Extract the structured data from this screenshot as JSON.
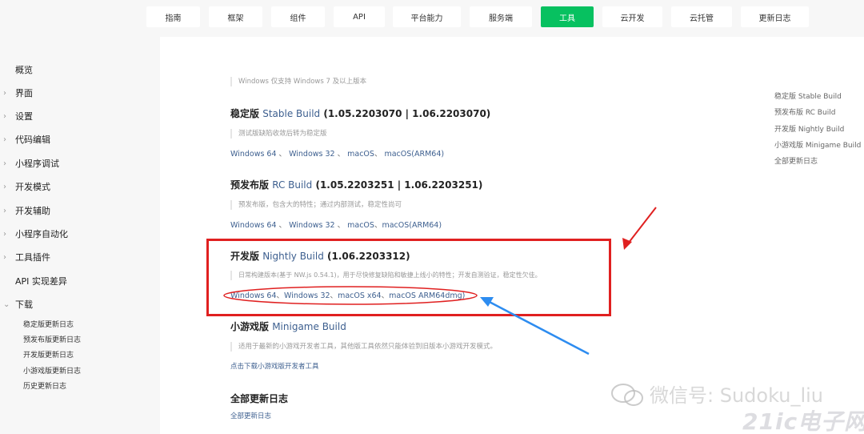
{
  "topnav": {
    "tabs": [
      {
        "label": "指南"
      },
      {
        "label": "框架"
      },
      {
        "label": "组件"
      },
      {
        "label": "API"
      },
      {
        "label": "平台能力"
      },
      {
        "label": "服务端"
      },
      {
        "label": "工具",
        "active": true
      },
      {
        "label": "云开发"
      },
      {
        "label": "云托管"
      },
      {
        "label": "更新日志"
      }
    ]
  },
  "sidebar": {
    "items": [
      {
        "label": "概览"
      },
      {
        "label": "界面"
      },
      {
        "label": "设置"
      },
      {
        "label": "代码编辑"
      },
      {
        "label": "小程序调试"
      },
      {
        "label": "开发模式"
      },
      {
        "label": "开发辅助"
      },
      {
        "label": "小程序自动化"
      },
      {
        "label": "工具插件"
      },
      {
        "label": "API 实现差异"
      },
      {
        "label": "下载"
      }
    ],
    "sub_items": [
      {
        "label": "稳定版更新日志"
      },
      {
        "label": "预发布版更新日志"
      },
      {
        "label": "开发版更新日志"
      },
      {
        "label": "小游戏版更新日志"
      },
      {
        "label": "历史更新日志"
      }
    ]
  },
  "main": {
    "top_note": "Windows 仅支持 Windows 7 及以上版本",
    "stable": {
      "title_prefix": "稳定版",
      "title_link": "Stable Build",
      "title_version": "(1.05.2203070 | 1.06.2203070)",
      "note": "测试版缺陷收敛后转为稳定版",
      "links": [
        "Windows 64",
        "Windows 32",
        "macOS",
        "macOS(ARM64)"
      ]
    },
    "rc": {
      "title_prefix": "预发布版",
      "title_link": "RC Build",
      "title_version": "(1.05.2203251 | 1.06.2203251)",
      "note": "预发布版，包含大的特性；通过内部测试，稳定性尚可",
      "links": [
        "Windows 64",
        "Windows 32",
        "macOS",
        "macOS(ARM64)"
      ]
    },
    "nightly": {
      "title_prefix": "开发版",
      "title_link": "Nightly Build",
      "title_version": "(1.06.2203312)",
      "note": "日常构建版本(基于 NW.js 0.54.1)，用于尽快修复缺陷和敏捷上线小的特性；开发自测验证，稳定性欠佳。",
      "links": [
        "Windows 64",
        "Windows 32",
        "macOS x64",
        "macOS ARM64dmg)"
      ]
    },
    "minigame": {
      "title_prefix": "小游戏版",
      "title_link": "Minigame Build",
      "note": "适用于最新的小游戏开发者工具，其他版工具依然只能体验到旧版本小游戏开发模式。",
      "link": "点击下载小游戏版开发者工具"
    },
    "all_logs": {
      "title": "全部更新日志",
      "link": "全部更新日志"
    }
  },
  "toc": {
    "items": [
      {
        "label": "稳定版 Stable Build"
      },
      {
        "label": "预发布版 RC Build"
      },
      {
        "label": "开发版 Nightly Build"
      },
      {
        "label": "小游戏版 Minigame Build"
      },
      {
        "label": "全部更新日志"
      }
    ]
  },
  "watermark": {
    "text": "微信号: Sudoku_liu",
    "text2": "21ic电子网"
  },
  "colors": {
    "accent": "#07c160",
    "link": "#3d5f8f",
    "annotation_red": "#e02020",
    "annotation_blue": "#2d8cf0"
  }
}
